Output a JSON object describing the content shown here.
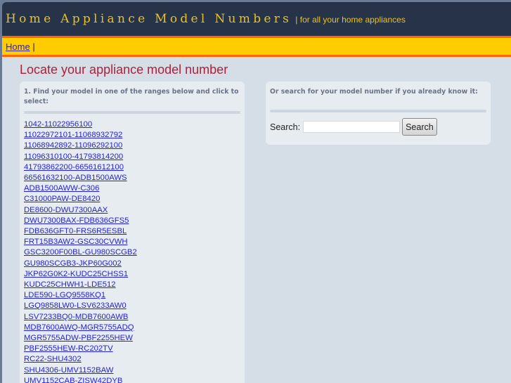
{
  "header": {
    "title": "Home Appliance Model Numbers",
    "tagline": "| for all your home appliances"
  },
  "nav": {
    "home": "Home",
    "sep": "|"
  },
  "main": {
    "heading": "Locate your appliance model number",
    "ranges_title": "1. Find your model in one of the ranges below and click to select:",
    "ranges": [
      "1042-11022956100",
      "11022972101-11068932792",
      "11068942892-11096292100",
      "11096310100-41793814200",
      "41793862200-66561612100",
      "66561632100-ADB1500AWS",
      "ADB1500AWW-C306",
      "C31000PAW-DE8420",
      "DE8600-DWU7300AAX",
      "DWU7300BAX-FDB636GFS5",
      "FDB636GFT0-FRS6R5ESBL",
      "FRT15B3AW2-GSC30CVWH",
      "GSC3200F00BL-GU980SCGB2",
      "GU980SCGB3-JKP60G002",
      "JKP62G0K2-KUDC25CHSS1",
      "KUDC25CHWH1-LDE512",
      "LDE590-LGQ9558KQ1",
      "LGQ9858LW0-LSV6233AW0",
      "LSV7233BQ0-MDB7600AWB",
      "MDB7600AWQ-MGR5755ADQ",
      "MGR5755ADW-PBF2255HEW",
      "PBF2555HEW-RC202TV",
      "RC22-SHU4302",
      "SHU4306-UMV1152BAW",
      "UMV1152CAB-ZISW42DYB"
    ],
    "search_title": "Or search for your model number if you already know it:",
    "search_label": "Search:",
    "search_value": "",
    "search_button": "Search"
  }
}
